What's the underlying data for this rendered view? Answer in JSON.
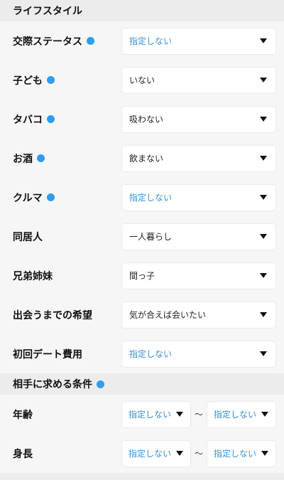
{
  "lifestyle": {
    "title": "ライフスタイル",
    "rows": [
      {
        "label": "交際ステータス",
        "value": "指定しない"
      },
      {
        "label": "子ども",
        "value": "いない"
      },
      {
        "label": "タバコ",
        "value": "吸わない"
      },
      {
        "label": "お酒",
        "value": "飲まない"
      },
      {
        "label": "クルマ",
        "value": "指定しない"
      },
      {
        "label": "同居人",
        "value": "一人暮らし"
      },
      {
        "label": "兄弟姉妹",
        "value": "間っ子"
      },
      {
        "label": "出会うまでの希望",
        "value": "気が合えば会いたい"
      },
      {
        "label": "初回デート費用",
        "value": "指定しない"
      }
    ]
  },
  "conditions": {
    "title": "相手に求める条件",
    "range_separator": "〜",
    "rows": [
      {
        "label": "年齢",
        "from": "指定しない",
        "to": "指定しない"
      },
      {
        "label": "身長",
        "from": "指定しない",
        "to": "指定しない"
      }
    ]
  },
  "colors": {
    "accent": "#2f9cf0",
    "unset_value": "#3a8fd0"
  }
}
